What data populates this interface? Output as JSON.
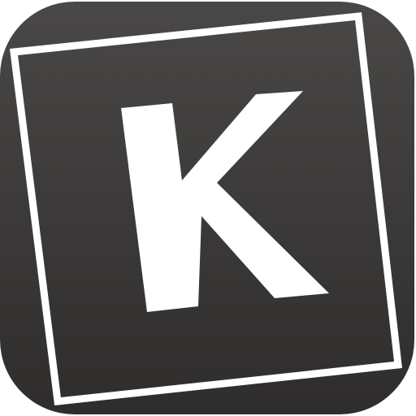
{
  "icon": {
    "name": "k-app-icon",
    "glyph": "K",
    "colors": {
      "background_top": "#4a4847",
      "background_bottom": "#2f2d2c",
      "frame": "#ffffff",
      "glyph": "#ffffff"
    }
  }
}
